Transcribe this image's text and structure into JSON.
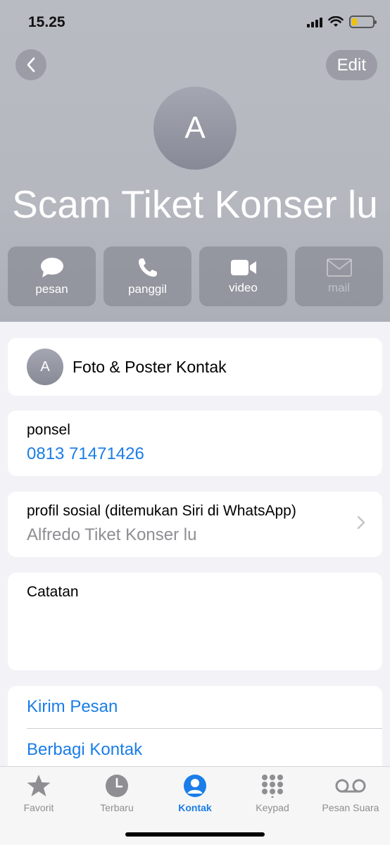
{
  "status_bar": {
    "time": "15.25",
    "battery_color": "#f2c200",
    "battery_level": 0.25
  },
  "header": {
    "edit_label": "Edit",
    "avatar_initial": "A",
    "contact_name": "Scam Tiket Konser lu"
  },
  "actions": [
    {
      "label": "pesan",
      "icon": "message-icon",
      "enabled": true
    },
    {
      "label": "panggil",
      "icon": "phone-icon",
      "enabled": true
    },
    {
      "label": "video",
      "icon": "video-camera-icon",
      "enabled": true
    },
    {
      "label": "mail",
      "icon": "mail-icon",
      "enabled": false
    }
  ],
  "photo_card": {
    "initial": "A",
    "label": "Foto & Poster Kontak"
  },
  "phone_card": {
    "label": "ponsel",
    "value": "0813 71471426"
  },
  "social_card": {
    "label": "profil sosial (ditemukan Siri di WhatsApp)",
    "value": "Alfredo Tiket Konser lu"
  },
  "notes_card": {
    "label": "Catatan"
  },
  "action_links": [
    {
      "label": "Kirim Pesan"
    },
    {
      "label": "Berbagi Kontak"
    }
  ],
  "tab_bar": {
    "tabs": [
      {
        "label": "Favorit",
        "icon": "star-icon",
        "active": false
      },
      {
        "label": "Terbaru",
        "icon": "clock-icon",
        "active": false
      },
      {
        "label": "Kontak",
        "icon": "person-icon",
        "active": true
      },
      {
        "label": "Keypad",
        "icon": "keypad-icon",
        "active": false
      },
      {
        "label": "Pesan Suara",
        "icon": "voicemail-icon",
        "active": false
      }
    ]
  },
  "colors": {
    "accent": "#1a7de8",
    "inactive": "#8e8e93"
  }
}
